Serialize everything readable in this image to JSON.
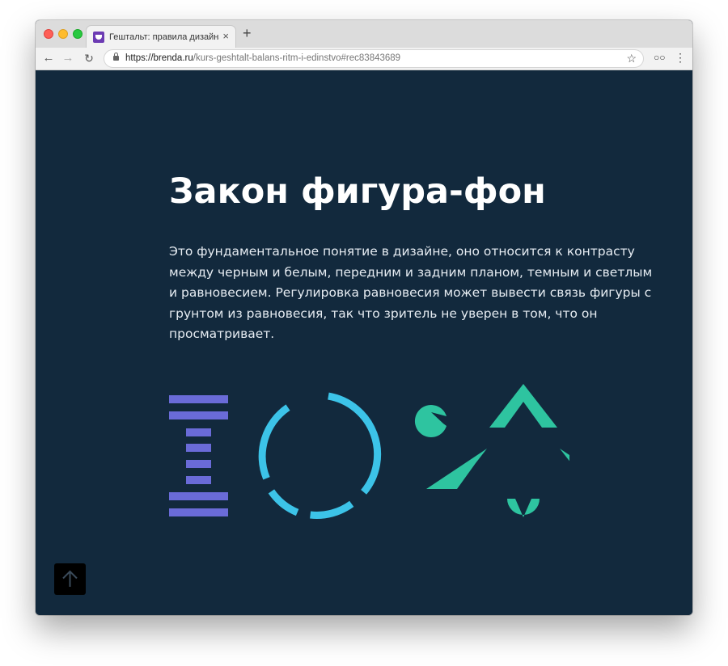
{
  "browser": {
    "tab_title": "Гештальт: правила дизайна. Ур",
    "tab_close": "×",
    "new_tab": "+",
    "url_main": "https://brenda.ru",
    "url_path": "/kurs-geshtalt-balans-ritm-i-edinstvo#rec83843689"
  },
  "page": {
    "heading": "Закон фигура-фон",
    "body": "Это фундаментальное понятие в дизайне, оно относится к контрасту между черным и белым, передним и задним планом, темным и светлым и равновесием. Регулировка равновесия может вывести связь фигуры с грунтом из равновесия, так что зритель не уверен в том, что он просматривает."
  },
  "colors": {
    "background": "#12293d",
    "figure_purple": "#6a6bd8",
    "figure_blue": "#3cc3e8",
    "figure_green": "#2ec4a0"
  },
  "icons": {
    "scroll_top": "arrow-up-icon"
  }
}
